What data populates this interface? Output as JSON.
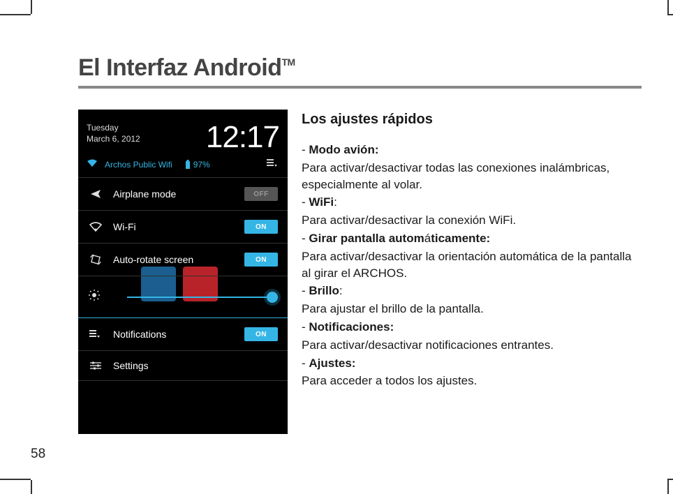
{
  "page_number": "58",
  "title": "El Interfaz Android",
  "title_tm": "TM",
  "subtitle": "Los ajustes rápidos",
  "body": {
    "l1a": "- ",
    "l1b": "Modo avión:",
    "l2": "Para activar/desactivar todas las conexiones inalámbricas, especialmente al volar.",
    "l3a": "- ",
    "l3b": "WiFi",
    "l3c": ":",
    "l4": "Para activar/desactivar la conexión WiFi.",
    "l5a": "- ",
    "l5b": "Girar pantalla autom",
    "l5c": "á",
    "l5d": "ticamente:",
    "l6": "Para activar/desactivar la orientación automática de la pantalla al girar el ARCHOS.",
    "l7a": "- ",
    "l7b": "Brillo",
    "l7c": ":",
    "l8": "Para ajustar el brillo de la pantalla.",
    "l9a": "- ",
    "l9b": "Notificaciones:",
    "l10": "Para activar/desactivar notificaciones entrantes.",
    "l11a": "- ",
    "l11b": "Ajustes:",
    "l12": "Para acceder a todos los ajustes."
  },
  "phone": {
    "day": "Tuesday",
    "date": "March 6, 2012",
    "clock": "12:17",
    "wifi_name": "Archos Public Wifi",
    "battery": "97%",
    "rows": {
      "airplane": "Airplane mode",
      "wifi": "Wi-Fi",
      "autorotate": "Auto-rotate screen",
      "notifications": "Notifications",
      "settings": "Settings"
    },
    "toggle_off": "OFF",
    "toggle_on": "ON"
  }
}
